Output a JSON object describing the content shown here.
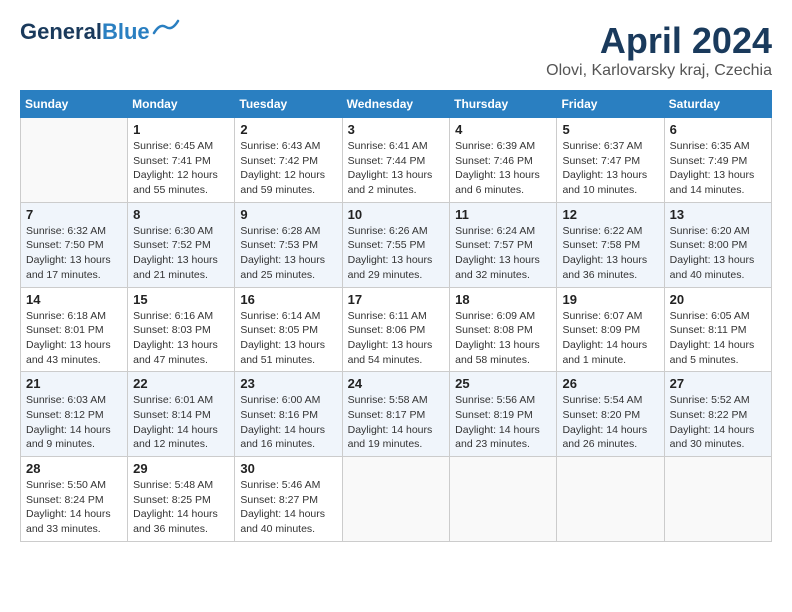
{
  "header": {
    "logo_line1": "General",
    "logo_line2": "Blue",
    "title": "April 2024",
    "subtitle": "Olovi, Karlovarsky kraj, Czechia"
  },
  "days_of_week": [
    "Sunday",
    "Monday",
    "Tuesday",
    "Wednesday",
    "Thursday",
    "Friday",
    "Saturday"
  ],
  "weeks": [
    [
      {
        "day": "",
        "info": ""
      },
      {
        "day": "1",
        "info": "Sunrise: 6:45 AM\nSunset: 7:41 PM\nDaylight: 12 hours\nand 55 minutes."
      },
      {
        "day": "2",
        "info": "Sunrise: 6:43 AM\nSunset: 7:42 PM\nDaylight: 12 hours\nand 59 minutes."
      },
      {
        "day": "3",
        "info": "Sunrise: 6:41 AM\nSunset: 7:44 PM\nDaylight: 13 hours\nand 2 minutes."
      },
      {
        "day": "4",
        "info": "Sunrise: 6:39 AM\nSunset: 7:46 PM\nDaylight: 13 hours\nand 6 minutes."
      },
      {
        "day": "5",
        "info": "Sunrise: 6:37 AM\nSunset: 7:47 PM\nDaylight: 13 hours\nand 10 minutes."
      },
      {
        "day": "6",
        "info": "Sunrise: 6:35 AM\nSunset: 7:49 PM\nDaylight: 13 hours\nand 14 minutes."
      }
    ],
    [
      {
        "day": "7",
        "info": "Sunrise: 6:32 AM\nSunset: 7:50 PM\nDaylight: 13 hours\nand 17 minutes."
      },
      {
        "day": "8",
        "info": "Sunrise: 6:30 AM\nSunset: 7:52 PM\nDaylight: 13 hours\nand 21 minutes."
      },
      {
        "day": "9",
        "info": "Sunrise: 6:28 AM\nSunset: 7:53 PM\nDaylight: 13 hours\nand 25 minutes."
      },
      {
        "day": "10",
        "info": "Sunrise: 6:26 AM\nSunset: 7:55 PM\nDaylight: 13 hours\nand 29 minutes."
      },
      {
        "day": "11",
        "info": "Sunrise: 6:24 AM\nSunset: 7:57 PM\nDaylight: 13 hours\nand 32 minutes."
      },
      {
        "day": "12",
        "info": "Sunrise: 6:22 AM\nSunset: 7:58 PM\nDaylight: 13 hours\nand 36 minutes."
      },
      {
        "day": "13",
        "info": "Sunrise: 6:20 AM\nSunset: 8:00 PM\nDaylight: 13 hours\nand 40 minutes."
      }
    ],
    [
      {
        "day": "14",
        "info": "Sunrise: 6:18 AM\nSunset: 8:01 PM\nDaylight: 13 hours\nand 43 minutes."
      },
      {
        "day": "15",
        "info": "Sunrise: 6:16 AM\nSunset: 8:03 PM\nDaylight: 13 hours\nand 47 minutes."
      },
      {
        "day": "16",
        "info": "Sunrise: 6:14 AM\nSunset: 8:05 PM\nDaylight: 13 hours\nand 51 minutes."
      },
      {
        "day": "17",
        "info": "Sunrise: 6:11 AM\nSunset: 8:06 PM\nDaylight: 13 hours\nand 54 minutes."
      },
      {
        "day": "18",
        "info": "Sunrise: 6:09 AM\nSunset: 8:08 PM\nDaylight: 13 hours\nand 58 minutes."
      },
      {
        "day": "19",
        "info": "Sunrise: 6:07 AM\nSunset: 8:09 PM\nDaylight: 14 hours\nand 1 minute."
      },
      {
        "day": "20",
        "info": "Sunrise: 6:05 AM\nSunset: 8:11 PM\nDaylight: 14 hours\nand 5 minutes."
      }
    ],
    [
      {
        "day": "21",
        "info": "Sunrise: 6:03 AM\nSunset: 8:12 PM\nDaylight: 14 hours\nand 9 minutes."
      },
      {
        "day": "22",
        "info": "Sunrise: 6:01 AM\nSunset: 8:14 PM\nDaylight: 14 hours\nand 12 minutes."
      },
      {
        "day": "23",
        "info": "Sunrise: 6:00 AM\nSunset: 8:16 PM\nDaylight: 14 hours\nand 16 minutes."
      },
      {
        "day": "24",
        "info": "Sunrise: 5:58 AM\nSunset: 8:17 PM\nDaylight: 14 hours\nand 19 minutes."
      },
      {
        "day": "25",
        "info": "Sunrise: 5:56 AM\nSunset: 8:19 PM\nDaylight: 14 hours\nand 23 minutes."
      },
      {
        "day": "26",
        "info": "Sunrise: 5:54 AM\nSunset: 8:20 PM\nDaylight: 14 hours\nand 26 minutes."
      },
      {
        "day": "27",
        "info": "Sunrise: 5:52 AM\nSunset: 8:22 PM\nDaylight: 14 hours\nand 30 minutes."
      }
    ],
    [
      {
        "day": "28",
        "info": "Sunrise: 5:50 AM\nSunset: 8:24 PM\nDaylight: 14 hours\nand 33 minutes."
      },
      {
        "day": "29",
        "info": "Sunrise: 5:48 AM\nSunset: 8:25 PM\nDaylight: 14 hours\nand 36 minutes."
      },
      {
        "day": "30",
        "info": "Sunrise: 5:46 AM\nSunset: 8:27 PM\nDaylight: 14 hours\nand 40 minutes."
      },
      {
        "day": "",
        "info": ""
      },
      {
        "day": "",
        "info": ""
      },
      {
        "day": "",
        "info": ""
      },
      {
        "day": "",
        "info": ""
      }
    ]
  ]
}
